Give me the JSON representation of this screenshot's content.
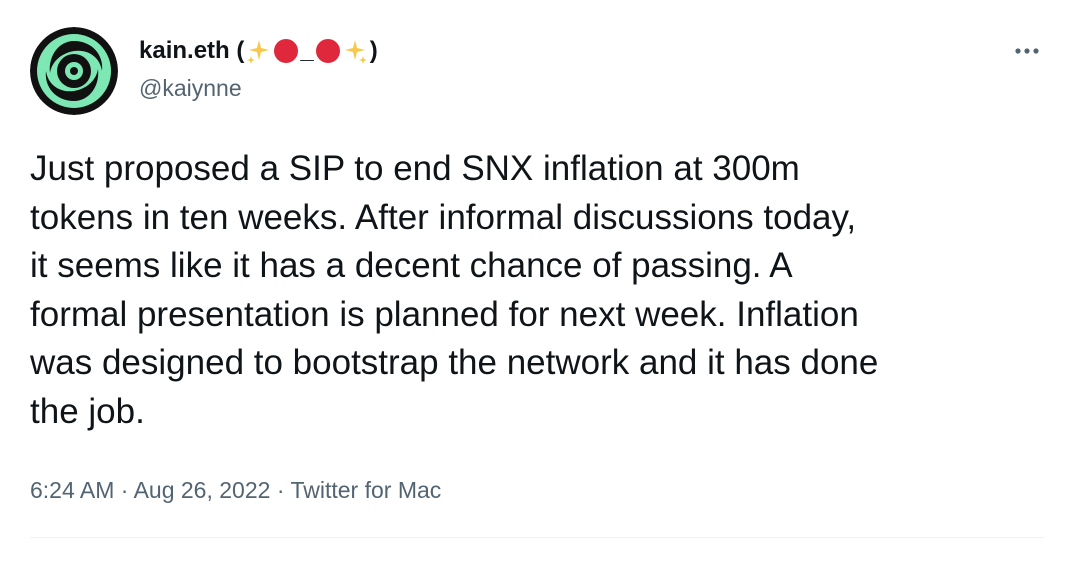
{
  "tweet": {
    "display_name": "kain.eth (",
    "display_name_middle": "_",
    "display_name_end": ")",
    "display_name_emojis": [
      "sparkles-emoji",
      "red-circle-emoji",
      "red-circle-emoji",
      "sparkles-emoji"
    ],
    "handle": "@kaiynne",
    "text": "Just proposed a SIP to end SNX inflation at 300m\ntokens in ten weeks. After informal discussions today,\nit seems like it has a decent chance of passing. A\nformal presentation is planned for next week. Inflation\nwas designed to bootstrap the network and it has done\nthe job.",
    "time": "6:24 AM",
    "separator": "·",
    "date": "Aug 26, 2022",
    "source": "Twitter for Mac"
  },
  "icons": {
    "more": "more-dots-icon",
    "avatar": "avatar-swirl"
  },
  "colors": {
    "text": "#0f1419",
    "secondary": "#536471",
    "avatar_bg": "#7ee8b4",
    "avatar_ring": "#111111",
    "red_dot": "#e0283c",
    "sparkle": "#f9c846"
  }
}
